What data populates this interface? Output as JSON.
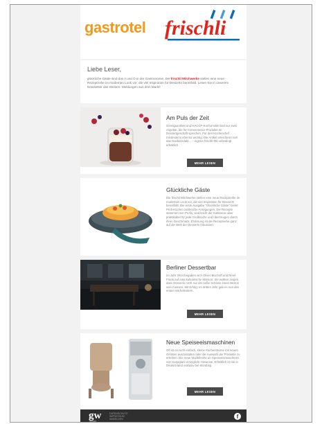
{
  "header": {
    "logo_left": "gastrotel",
    "logo_right": "frischli"
  },
  "intro": {
    "greeting": "Liebe Leser,",
    "text_before": "glückliche Gäste sind das A und O in der Gastronomie. Die ",
    "brand": "frischli Milchwerke",
    "text_after": " stellen eine neue Rezeptreihe im modernen Look vor, die viel Inspiration für Desserts bereithält. Lesen Sie in unserem Newsletter das Weitere: Meldungen aus dem Markt!"
  },
  "sections": [
    {
      "title": "Am Puls der Zeit",
      "text": "Genügsamkeit und HACCP-Konformität sind nur zwei Aspekte, die für Convenience-Produkte im Dessertgeschäft sprechen. Für den Küchenchef mindestens ebenso wichtig: Die Artikel erleichtern sich das Dasbaredakt... – eigene frischli-Mit unbedingt erhältlich.",
      "button": "MEHR LESEN"
    },
    {
      "title": "Glückliche Gäste",
      "text": "Die frischli Milchwerke stellen eine neue Rezeptreihe im modernen Look vor, die viel Inspiration für Desserts bereithält. Die erste Ausgabe \"Glückliche Gäste\" bietet Profi-Küchen zahlreiche Anregungen. Die Rezepte stammen von Profis, sind leicht der Kaltkreise aber praktikabel für jede Großküche und überzeugen durch ihren Geschmack. Erdenung ist die Rezeptreihe ganz auf die Welt der Desserts fokussiert.",
      "button": ""
    },
    {
      "title": "Berliner Dessertbar",
      "text": "Im Jahr 2014 begaben sich Oliver Bischoff und René Frank auf eine kulinarische Mission: Sie wollten zeigen, dass Desserts nicht nur der süße Schluss eines Menüs sein müssen. Mit Erfolg: Im dritten Jahr gab es nun den ersten Michelinstern.",
      "button": "MEHR LESEN"
    },
    {
      "title": "Neue Speiseeismaschinen",
      "text": "Oft ist es nicht einfach, kleine Küchenräume mit neuen Geräten auszustatten oder die Auswahl der Produkte zu erhöhen. Die neue Modellreihe an Speiseeismaschinen von Carpigiani ermöglicht Hinweise. Erhältlich ist sie in Deutschland exklusiv bei MonEisp.",
      "button": "MEHR LESEN"
    }
  ],
  "footer": {
    "logo": "gw",
    "logo_sub": "verlag",
    "lines": [
      "Datenschutz",
      "Impressum",
      "Abmelden"
    ],
    "social": "f",
    "social_icon": "facebook-icon"
  },
  "colors": {
    "brand_red": "#e2231a",
    "brand_blue": "#0a6db3",
    "gastrotel_orange": "#f39a1e",
    "button_bg": "#4a4a4a",
    "footer_bg": "#2f2f2f"
  }
}
